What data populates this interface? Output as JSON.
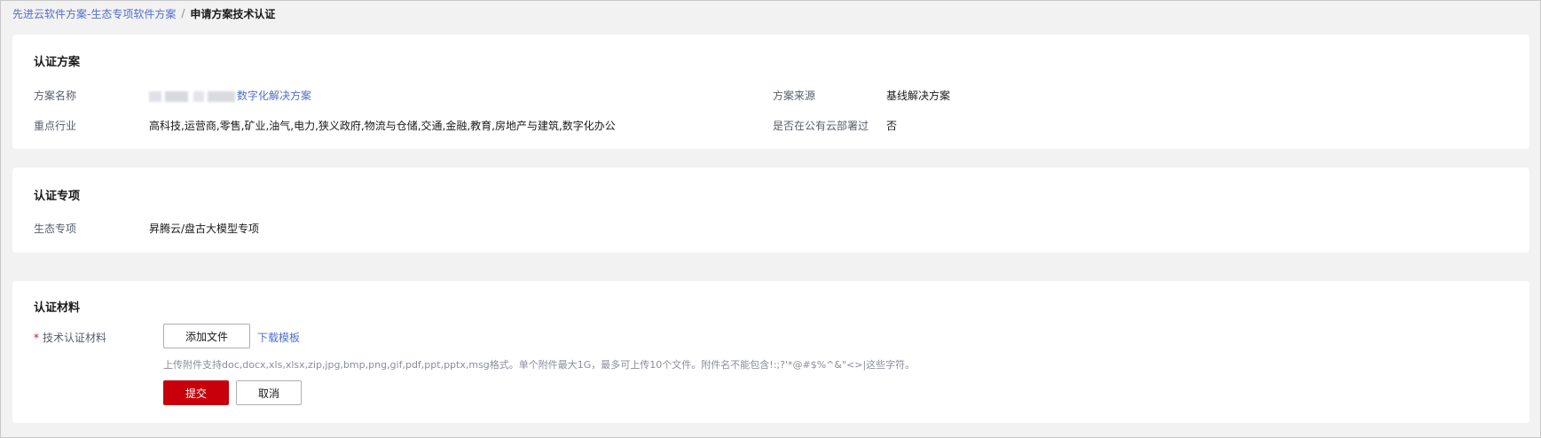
{
  "breadcrumb": {
    "parent": "先进云软件方案-生态专项软件方案",
    "separator": "/",
    "current": "申请方案技术认证"
  },
  "solution": {
    "title": "认证方案",
    "name_label": "方案名称",
    "name_value": "数字化解决方案",
    "industry_label": "重点行业",
    "industry_value": "高科技,运营商,零售,矿业,油气,电力,狭义政府,物流与仓储,交通,金融,教育,房地产与建筑,数字化办公",
    "source_label": "方案来源",
    "source_value": "基线解决方案",
    "public_cloud_label": "是否在公有云部署过",
    "public_cloud_value": "否"
  },
  "special": {
    "title": "认证专项",
    "eco_label": "生态专项",
    "eco_value": "昇腾云/盘古大模型专项"
  },
  "materials": {
    "title": "认证材料",
    "required_mark": "*",
    "tech_label": "技术认证材料",
    "add_file_button": "添加文件",
    "download_template_link": "下载模板",
    "upload_hint": "上传附件支持doc,docx,xls,xlsx,zip,jpg,bmp,png,gif,pdf,ppt,pptx,msg格式。单个附件最大1G，最多可上传10个文件。附件名不能包含!:;?'*@#$%^&\"<>|这些字符。",
    "submit_button": "提交",
    "cancel_button": "取消"
  },
  "colors": {
    "link": "#526ecc",
    "primary": "#c7000b",
    "required": "#e6002e"
  }
}
